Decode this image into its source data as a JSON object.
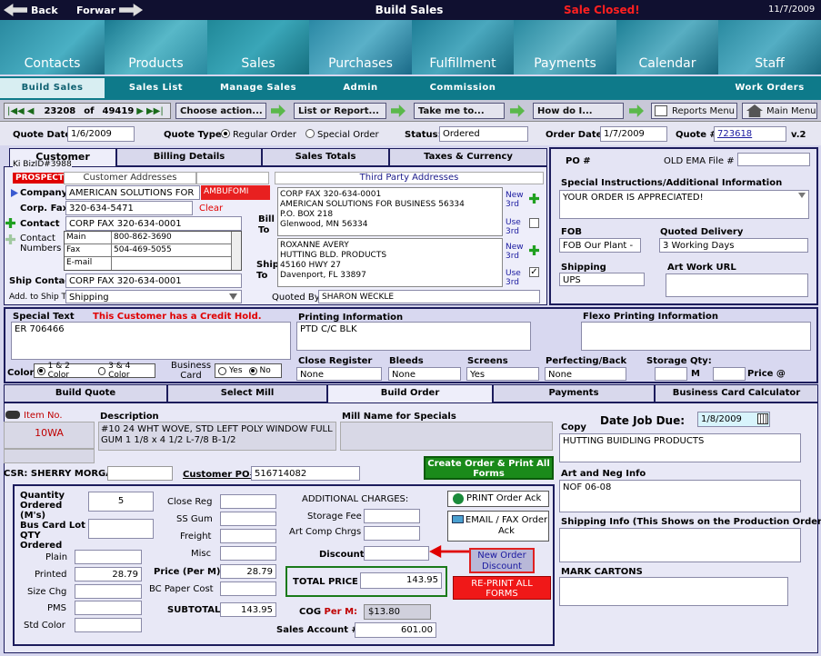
{
  "window": {
    "back": "Back",
    "forward": "Forwar",
    "title": "Build Sales",
    "status": "Sale Closed!",
    "date": "11/7/2009"
  },
  "nav": [
    "Contacts",
    "Products",
    "Sales",
    "Purchases",
    "Fulfillment",
    "Payments",
    "Calendar",
    "Staff"
  ],
  "subnav": [
    "Build Sales",
    "Sales List",
    "Manage Sales",
    "Admin",
    "Commission",
    "Work Orders"
  ],
  "toolbar": {
    "record": "23208",
    "of": "of",
    "total": "49419",
    "choose": "Choose action...",
    "list": "List or Report...",
    "take": "Take me to...",
    "how": "How do I...",
    "reports": "Reports Menu",
    "main": "Main Menu"
  },
  "header": {
    "quote_date_label": "Quote Date:",
    "quote_date": "1/6/2009",
    "quote_type_label": "Quote Type:",
    "regular": "Regular Order",
    "special": "Special Order",
    "status_label": "Status:",
    "status": "Ordered",
    "order_date_label": "Order Date:",
    "order_date": "1/7/2009",
    "quote_num_label": "Quote #",
    "quote_num": "723618",
    "version": "v.2"
  },
  "tabs": [
    "Customer",
    "Billing Details",
    "Sales Totals",
    "Taxes & Currency"
  ],
  "customer": {
    "kibiz": "Ki BizID#3988",
    "prospect": "PROSPECT",
    "addresses_title": "Customer Addresses",
    "company_label": "Company",
    "company": "AMERICAN SOLUTIONS FOR",
    "company_code": "AMBUFOMI",
    "corp_fax_label": "Corp. Fax",
    "corp_fax": "320-634-5471",
    "clear": "Clear",
    "contact_label": "Contact",
    "contact": "CORP FAX 320-634-0001",
    "numbers_label": "Contact Numbers",
    "numbers": [
      [
        "Main",
        "800-862-3690"
      ],
      [
        "Fax",
        "504-469-5055"
      ],
      [
        "E-mail",
        ""
      ]
    ],
    "ship_contact_label": "Ship Contact",
    "ship_contact": "CORP FAX 320-634-0001",
    "add_ship_label": "Add. to Ship To",
    "add_ship": "Shipping"
  },
  "third_party": {
    "title": "Third Party Addresses",
    "bill_label": "Bill To",
    "bill": [
      "CORP FAX 320-634-0001",
      "AMERICAN SOLUTIONS FOR BUSINESS 56334",
      "P.O. BOX 218",
      "Glenwood, MN 56334"
    ],
    "ship_label": "Ship To",
    "ship": [
      "ROXANNE AVERY",
      "HUTTING BLD. PRODUCTS",
      "45160 HWY 27",
      "Davenport, FL 33897"
    ],
    "new3rd": "New 3rd",
    "use3rd": "Use 3rd",
    "quoted_by_label": "Quoted By:",
    "quoted_by": "SHARON WECKLE"
  },
  "right": {
    "po_label": "PO #",
    "old_ema_label": "OLD EMA File #",
    "special_label": "Special Instructions/Additional Information",
    "special": "YOUR ORDER IS APPRECIATED!",
    "fob_label": "FOB",
    "fob": "FOB Our Plant -",
    "delivery_label": "Quoted Delivery",
    "delivery": "3 Working Days",
    "shipping_label": "Shipping",
    "shipping": "UPS",
    "artwork_label": "Art Work URL"
  },
  "mid": {
    "special_text_label": "Special Text",
    "credit_hold": "This Customer has a Credit Hold.",
    "special_text": "ER 706466",
    "printing_label": "Printing Information",
    "printing": "PTD C/C BLK",
    "flexo_label": "Flexo Printing Information",
    "close_reg_label": "Close Register",
    "close_reg": "None",
    "bleeds_label": "Bleeds",
    "bleeds": "None",
    "screens_label": "Screens",
    "screens": "Yes",
    "perfecting_label": "Perfecting/Back",
    "perfecting": "None",
    "storage_label": "Storage Qty:",
    "m": "M",
    "price_at": "Price @",
    "color_label": "Color",
    "color1": "1 & 2 Color",
    "color2": "3 & 4 Color",
    "bizcard_label": "Business Card",
    "yes": "Yes",
    "no": "No"
  },
  "lower_tabs": [
    "Build Quote",
    "Select Mill",
    "Build Order",
    "Payments",
    "Business Card Calculator"
  ],
  "order": {
    "item_label": "Item No.",
    "item": "10WA",
    "desc_label": "Description",
    "desc": "#10 24 WHT WOVE, STD LEFT POLY WINDOW FULL GUM 1 1/8 x 4 1/2 L-7/8 B-1/2",
    "mill_label": "Mill Name for Specials",
    "csr_label": "CSR:",
    "csr": "SHERRY MORGAN",
    "cust_po_label": "Customer PO#",
    "cust_po": "516714082",
    "create": "Create Order & Print All Forms",
    "qty_label": "Quantity Ordered (M's)",
    "qty": "5",
    "buscard_label": "Bus Card Lot QTY Ordered",
    "plain_label": "Plain",
    "printed_label": "Printed",
    "printed": "28.79",
    "sizechg_label": "Size Chg",
    "pms_label": "PMS",
    "stdcolor_label": "Std Color",
    "closereg_label": "Close Reg",
    "ssgum_label": "SS Gum",
    "freight_label": "Freight",
    "misc_label": "Misc",
    "price_label": "Price (Per M)",
    "price": "28.79",
    "bcpaper_label": "BC Paper Cost",
    "subtotal_label": "SUBTOTAL",
    "subtotal": "143.95",
    "addl_label": "ADDITIONAL CHARGES:",
    "storage_fee_label": "Storage Fee",
    "artcomp_label": "Art Comp Chrgs",
    "discount_label": "Discount",
    "total_label": "TOTAL PRICE",
    "total": "143.95",
    "cog_label": "COG",
    "per_m": "Per M:",
    "cog": "$13.80",
    "sales_acct_label": "Sales Account #",
    "sales_acct": "601.00",
    "print_ack": "PRINT Order Ack",
    "email_ack": "EMAIL / FAX Order Ack",
    "new_discount": "New Order Discount",
    "reprint": "RE-PRINT ALL FORMS"
  },
  "side": {
    "due_label": "Date Job Due:",
    "due": "1/8/2009",
    "copy_label": "Copy",
    "copy": "HUTTING BUIDLING PRODUCTS",
    "artneg_label": "Art and Neg Info",
    "artneg": "NOF 06-08",
    "shipinfo_label": "Shipping Info (This Shows on the Production Order)",
    "marks_label": "MARK CARTONS"
  },
  "colors": {
    "navy": "#1c1c5c",
    "teal": "#0e7a8a",
    "red": "#e00000"
  }
}
